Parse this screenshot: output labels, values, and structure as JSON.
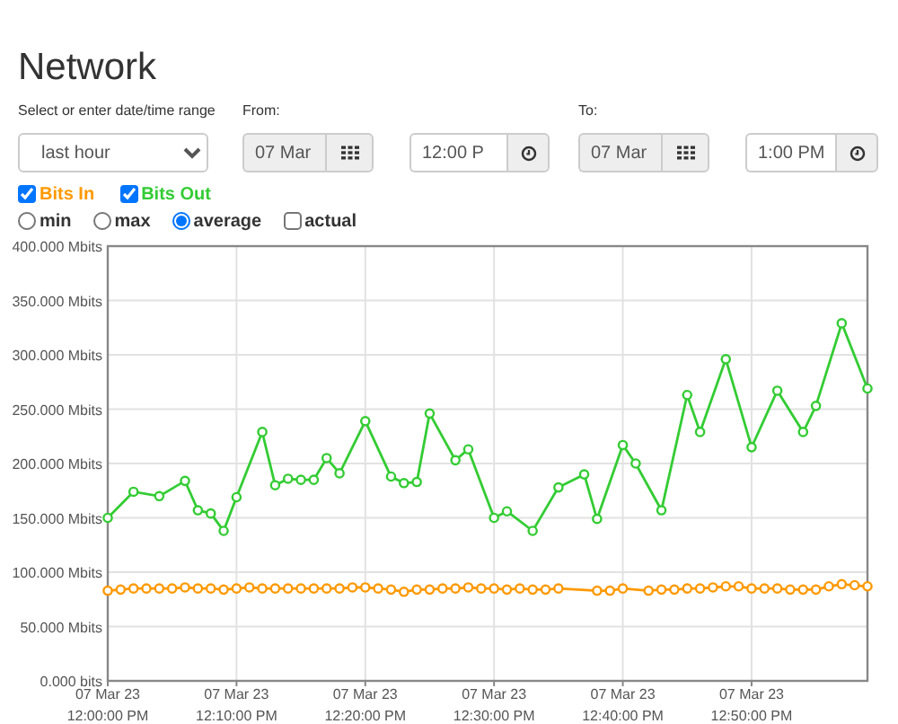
{
  "page_title": "Network",
  "range": {
    "label": "Select or enter date/time range",
    "value": "last hour"
  },
  "from": {
    "label": "From:",
    "date": "07 Mar",
    "date_disabled": true,
    "time": "12:00 P"
  },
  "to": {
    "label": "To:",
    "date": "07 Mar",
    "date_disabled": true,
    "time": "1:00 PM"
  },
  "series_toggles": [
    {
      "checked": true
    },
    {
      "checked": true
    }
  ],
  "modes": [
    {
      "kind": "radio",
      "label": "min",
      "selected": false
    },
    {
      "kind": "radio",
      "label": "max",
      "selected": false
    },
    {
      "kind": "radio",
      "label": "average",
      "selected": true
    },
    {
      "kind": "checkbox",
      "label": "actual",
      "checked": false
    }
  ],
  "chart_data": {
    "type": "line",
    "categories": [
      "07 Mar 23\n12:00:00 PM",
      null,
      null,
      null,
      null,
      null,
      null,
      null,
      null,
      null,
      "07 Mar 23\n12:10:00 PM",
      null,
      null,
      null,
      null,
      null,
      null,
      null,
      null,
      null,
      "07 Mar 23\n12:20:00 PM",
      null,
      null,
      null,
      null,
      null,
      null,
      null,
      null,
      null,
      "07 Mar 23\n12:30:00 PM",
      null,
      null,
      null,
      null,
      null,
      null,
      null,
      null,
      null,
      "07 Mar 23\n12:40:00 PM",
      null,
      null,
      null,
      null,
      null,
      null,
      null,
      null,
      null,
      "07 Mar 23\n12:50:00 PM",
      null,
      null,
      null,
      null,
      null,
      null,
      null,
      null,
      null
    ],
    "ylim": [
      0,
      400
    ],
    "grid": true,
    "yticks": [
      {
        "value": 0,
        "label": "0.000 bits"
      },
      {
        "value": 50,
        "label": "50.000 Mbits"
      },
      {
        "value": 100,
        "label": "100.000 Mbits"
      },
      {
        "value": 150,
        "label": "150.000 Mbits"
      },
      {
        "value": 200,
        "label": "200.000 Mbits"
      },
      {
        "value": 250,
        "label": "250.000 Mbits"
      },
      {
        "value": 300,
        "label": "300.000 Mbits"
      },
      {
        "value": 350,
        "label": "350.000 Mbits"
      },
      {
        "value": 400,
        "label": "400.000 Mbits"
      }
    ],
    "series": [
      {
        "name": "Bits In",
        "color": "#ff9900",
        "marker": "circle",
        "values": [
          83,
          84,
          85,
          85,
          85,
          85,
          86,
          85,
          85,
          84,
          85,
          86,
          85,
          85,
          85,
          85,
          85,
          85,
          85,
          86,
          86,
          85,
          84,
          82,
          84,
          84,
          85,
          85,
          86,
          85,
          85,
          84,
          85,
          84,
          84,
          85,
          null,
          null,
          83,
          83,
          85,
          null,
          83,
          84,
          84,
          85,
          85,
          86,
          87,
          87,
          85,
          85,
          85,
          84,
          84,
          84,
          87,
          89,
          88,
          87
        ]
      },
      {
        "name": "Bits Out",
        "color": "#33cc33",
        "marker": "circle",
        "values": [
          150,
          null,
          174,
          null,
          170,
          null,
          184,
          157,
          154,
          138,
          169,
          null,
          229,
          180,
          186,
          185,
          185,
          205,
          191,
          null,
          239,
          null,
          188,
          182,
          183,
          246,
          null,
          203,
          213,
          null,
          150,
          156,
          null,
          138,
          null,
          178,
          null,
          190,
          149,
          null,
          217,
          200,
          null,
          157,
          null,
          263,
          229,
          null,
          296,
          null,
          215,
          null,
          267,
          null,
          229,
          253,
          null,
          329,
          null,
          269
        ]
      }
    ]
  }
}
